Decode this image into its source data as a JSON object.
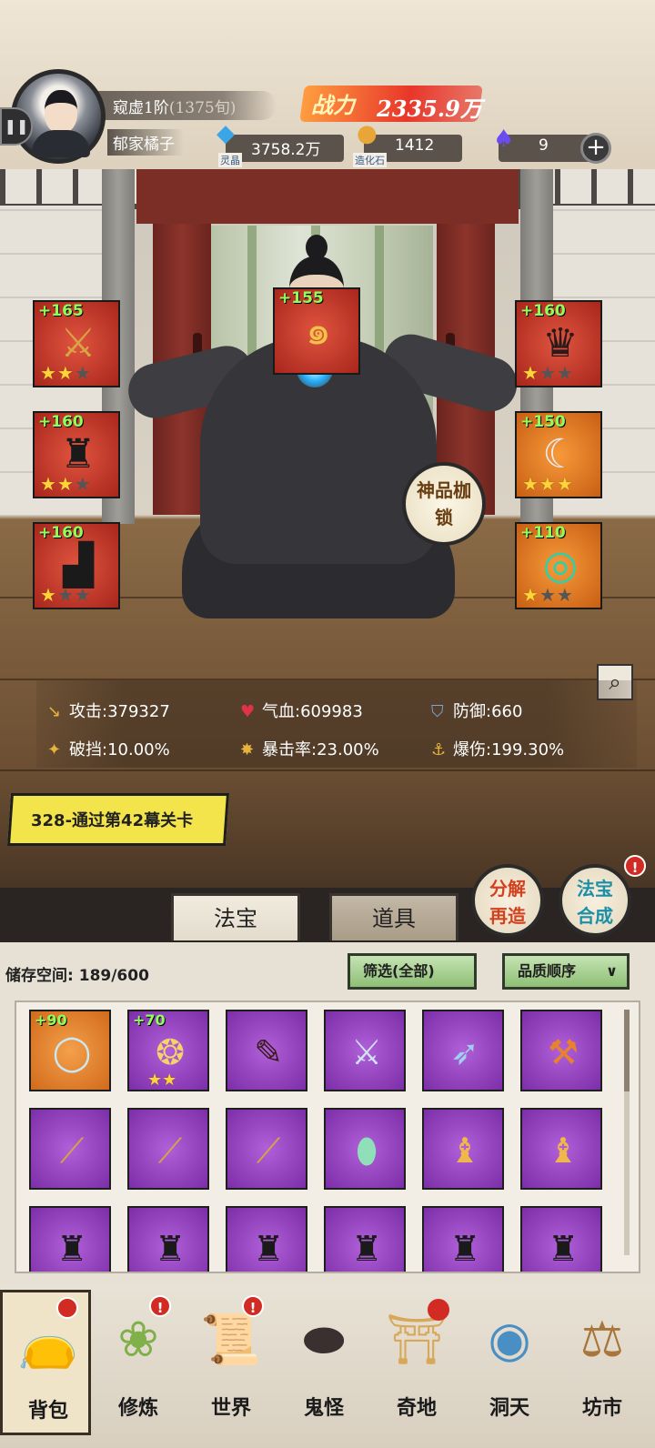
{
  "header": {
    "realm": "窥虚1阶",
    "realm_turn": "(1375旬)",
    "player_name": "郁家橘子",
    "power_label": "战力",
    "power_value": "2335.9万",
    "resources": [
      {
        "icon": "spirit-crystal-icon",
        "value": "3758.2万",
        "caption": "灵晶"
      },
      {
        "icon": "creation-stone-icon",
        "value": "1412",
        "caption": "造化石"
      },
      {
        "icon": "purple-flame-icon",
        "value": "9"
      }
    ]
  },
  "equipment": [
    {
      "slot": "left-1",
      "plus": "+165",
      "stars": 2,
      "quality": "red",
      "icon": "sword-chain-icon"
    },
    {
      "slot": "top-center",
      "plus": "+155",
      "stars": 0,
      "quality": "red",
      "icon": "golden-dragon-icon"
    },
    {
      "slot": "right-1",
      "plus": "+160",
      "stars": 1,
      "quality": "red",
      "icon": "headband-icon"
    },
    {
      "slot": "left-2",
      "plus": "+160",
      "stars": 2,
      "quality": "red",
      "icon": "robe-icon"
    },
    {
      "slot": "right-2",
      "plus": "+150",
      "stars": 3,
      "quality": "orange",
      "icon": "pendant-icon"
    },
    {
      "slot": "left-3",
      "plus": "+160",
      "stars": 1,
      "quality": "red",
      "icon": "boots-icon"
    },
    {
      "slot": "right-3",
      "plus": "+110",
      "stars": 1,
      "quality": "orange",
      "icon": "jade-ring-icon"
    }
  ],
  "divine_button": "神品枷锁",
  "stats": [
    {
      "icon": "attack-icon",
      "label": "攻击:",
      "value": "379327"
    },
    {
      "icon": "heart-icon",
      "label": "气血:",
      "value": "609983"
    },
    {
      "icon": "shield-icon",
      "label": "防御:",
      "value": "660"
    },
    {
      "icon": "break-block-icon",
      "label": "破挡:",
      "value": "10.00%"
    },
    {
      "icon": "crit-rate-icon",
      "label": "暴击率:",
      "value": "23.00%"
    },
    {
      "icon": "crit-damage-icon",
      "label": "爆伤:",
      "value": "199.30%"
    }
  ],
  "quest": "328-通过第42幕关卡",
  "tabs": [
    "法宝",
    "道具"
  ],
  "actions": [
    {
      "label": "分解再造",
      "badge": ""
    },
    {
      "label": "法宝合成",
      "badge": "!"
    }
  ],
  "inventory": {
    "storage_label": "储存空间:",
    "storage_value": "189/600",
    "filter_label": "筛选(全部)",
    "sort_label": "品质顺序",
    "items": [
      {
        "plus": "+90",
        "stars": 0,
        "quality": "orange",
        "icon": "silver-bracelet-icon"
      },
      {
        "plus": "+70",
        "stars": 2,
        "quality": "purple",
        "icon": "gold-amulet-icon"
      },
      {
        "plus": "",
        "stars": 0,
        "quality": "purple",
        "icon": "dark-dagger-icon"
      },
      {
        "plus": "",
        "stars": 0,
        "quality": "purple",
        "icon": "ice-sword-icon"
      },
      {
        "plus": "",
        "stars": 0,
        "quality": "purple",
        "icon": "crossbow-icon"
      },
      {
        "plus": "",
        "stars": 0,
        "quality": "purple",
        "icon": "flame-axe-icon"
      },
      {
        "plus": "",
        "stars": 0,
        "quality": "purple",
        "icon": "golden-staff-icon"
      },
      {
        "plus": "",
        "stars": 0,
        "quality": "purple",
        "icon": "golden-staff-icon"
      },
      {
        "plus": "",
        "stars": 0,
        "quality": "purple",
        "icon": "golden-staff-icon"
      },
      {
        "plus": "",
        "stars": 0,
        "quality": "purple",
        "icon": "jade-fan-icon"
      },
      {
        "plus": "",
        "stars": 0,
        "quality": "purple",
        "icon": "golden-armor-icon"
      },
      {
        "plus": "",
        "stars": 0,
        "quality": "purple",
        "icon": "golden-armor-icon"
      },
      {
        "plus": "",
        "stars": 0,
        "quality": "purple",
        "icon": "dark-robe-icon"
      },
      {
        "plus": "",
        "stars": 0,
        "quality": "purple",
        "icon": "dark-robe-icon"
      },
      {
        "plus": "",
        "stars": 0,
        "quality": "purple",
        "icon": "dark-robe-icon"
      },
      {
        "plus": "",
        "stars": 0,
        "quality": "purple",
        "icon": "dark-robe-icon"
      },
      {
        "plus": "",
        "stars": 0,
        "quality": "purple",
        "icon": "dark-robe-icon"
      },
      {
        "plus": "",
        "stars": 0,
        "quality": "purple",
        "icon": "dark-robe-icon"
      }
    ]
  },
  "nav": [
    {
      "label": "背包",
      "icon": "backpack-icon",
      "badge": "",
      "active": true
    },
    {
      "label": "修炼",
      "icon": "cultivate-icon",
      "badge": "!",
      "active": false
    },
    {
      "label": "世界",
      "icon": "world-scroll-icon",
      "badge": "!",
      "active": false
    },
    {
      "label": "鬼怪",
      "icon": "demon-egg-icon",
      "badge": "",
      "active": false
    },
    {
      "label": "奇地",
      "icon": "wonderland-icon",
      "badge": "",
      "active": false
    },
    {
      "label": "洞天",
      "icon": "portal-icon",
      "badge": "",
      "active": false
    },
    {
      "label": "坊市",
      "icon": "market-icon",
      "badge": "",
      "active": false
    }
  ],
  "colors": {
    "quality_red": "#c63a2c",
    "quality_orange": "#e57e28",
    "quality_purple": "#9a46c4",
    "plus_text": "#8dff5a",
    "star": "#ffd43b"
  }
}
